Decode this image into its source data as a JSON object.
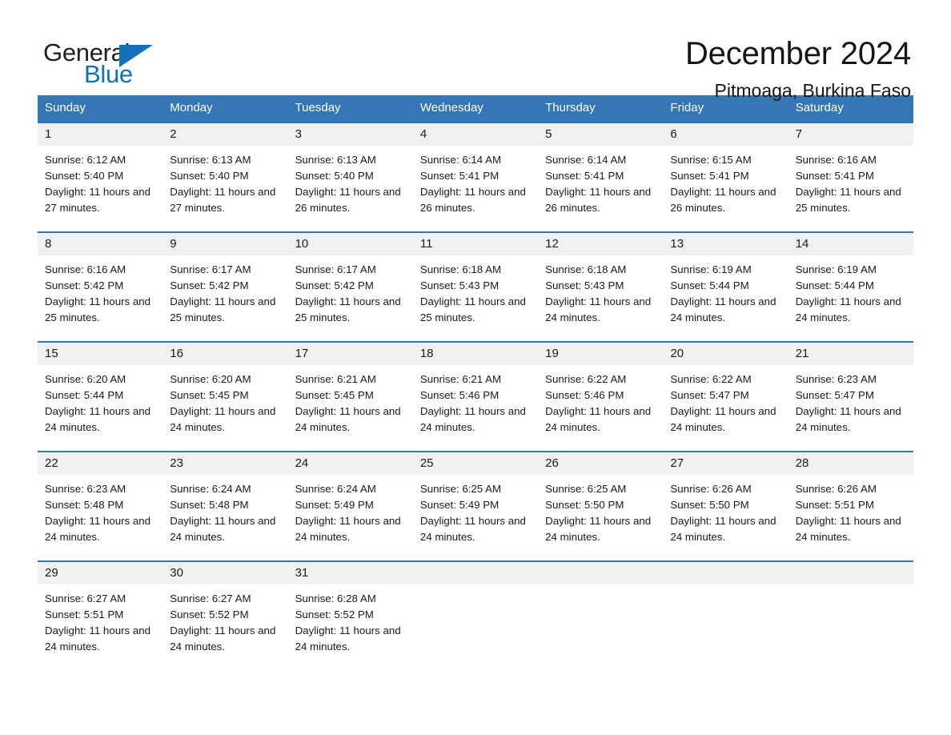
{
  "brand": {
    "name_part1": "General",
    "name_part2": "Blue",
    "logo_icon": "triangle-flag-icon",
    "accent_color": "#1271b8"
  },
  "header": {
    "month_title": "December 2024",
    "location": "Pitmoaga, Burkina Faso"
  },
  "calendar": {
    "header_bg_color": "#3576b5",
    "daynum_bg_color": "#f1f1f1",
    "weekdays": [
      "Sunday",
      "Monday",
      "Tuesday",
      "Wednesday",
      "Thursday",
      "Friday",
      "Saturday"
    ],
    "weeks": [
      {
        "days": [
          {
            "num": "1",
            "sunrise": "Sunrise: 6:12 AM",
            "sunset": "Sunset: 5:40 PM",
            "daylight": "Daylight: 11 hours and 27 minutes."
          },
          {
            "num": "2",
            "sunrise": "Sunrise: 6:13 AM",
            "sunset": "Sunset: 5:40 PM",
            "daylight": "Daylight: 11 hours and 27 minutes."
          },
          {
            "num": "3",
            "sunrise": "Sunrise: 6:13 AM",
            "sunset": "Sunset: 5:40 PM",
            "daylight": "Daylight: 11 hours and 26 minutes."
          },
          {
            "num": "4",
            "sunrise": "Sunrise: 6:14 AM",
            "sunset": "Sunset: 5:41 PM",
            "daylight": "Daylight: 11 hours and 26 minutes."
          },
          {
            "num": "5",
            "sunrise": "Sunrise: 6:14 AM",
            "sunset": "Sunset: 5:41 PM",
            "daylight": "Daylight: 11 hours and 26 minutes."
          },
          {
            "num": "6",
            "sunrise": "Sunrise: 6:15 AM",
            "sunset": "Sunset: 5:41 PM",
            "daylight": "Daylight: 11 hours and 26 minutes."
          },
          {
            "num": "7",
            "sunrise": "Sunrise: 6:16 AM",
            "sunset": "Sunset: 5:41 PM",
            "daylight": "Daylight: 11 hours and 25 minutes."
          }
        ]
      },
      {
        "days": [
          {
            "num": "8",
            "sunrise": "Sunrise: 6:16 AM",
            "sunset": "Sunset: 5:42 PM",
            "daylight": "Daylight: 11 hours and 25 minutes."
          },
          {
            "num": "9",
            "sunrise": "Sunrise: 6:17 AM",
            "sunset": "Sunset: 5:42 PM",
            "daylight": "Daylight: 11 hours and 25 minutes."
          },
          {
            "num": "10",
            "sunrise": "Sunrise: 6:17 AM",
            "sunset": "Sunset: 5:42 PM",
            "daylight": "Daylight: 11 hours and 25 minutes."
          },
          {
            "num": "11",
            "sunrise": "Sunrise: 6:18 AM",
            "sunset": "Sunset: 5:43 PM",
            "daylight": "Daylight: 11 hours and 25 minutes."
          },
          {
            "num": "12",
            "sunrise": "Sunrise: 6:18 AM",
            "sunset": "Sunset: 5:43 PM",
            "daylight": "Daylight: 11 hours and 24 minutes."
          },
          {
            "num": "13",
            "sunrise": "Sunrise: 6:19 AM",
            "sunset": "Sunset: 5:44 PM",
            "daylight": "Daylight: 11 hours and 24 minutes."
          },
          {
            "num": "14",
            "sunrise": "Sunrise: 6:19 AM",
            "sunset": "Sunset: 5:44 PM",
            "daylight": "Daylight: 11 hours and 24 minutes."
          }
        ]
      },
      {
        "days": [
          {
            "num": "15",
            "sunrise": "Sunrise: 6:20 AM",
            "sunset": "Sunset: 5:44 PM",
            "daylight": "Daylight: 11 hours and 24 minutes."
          },
          {
            "num": "16",
            "sunrise": "Sunrise: 6:20 AM",
            "sunset": "Sunset: 5:45 PM",
            "daylight": "Daylight: 11 hours and 24 minutes."
          },
          {
            "num": "17",
            "sunrise": "Sunrise: 6:21 AM",
            "sunset": "Sunset: 5:45 PM",
            "daylight": "Daylight: 11 hours and 24 minutes."
          },
          {
            "num": "18",
            "sunrise": "Sunrise: 6:21 AM",
            "sunset": "Sunset: 5:46 PM",
            "daylight": "Daylight: 11 hours and 24 minutes."
          },
          {
            "num": "19",
            "sunrise": "Sunrise: 6:22 AM",
            "sunset": "Sunset: 5:46 PM",
            "daylight": "Daylight: 11 hours and 24 minutes."
          },
          {
            "num": "20",
            "sunrise": "Sunrise: 6:22 AM",
            "sunset": "Sunset: 5:47 PM",
            "daylight": "Daylight: 11 hours and 24 minutes."
          },
          {
            "num": "21",
            "sunrise": "Sunrise: 6:23 AM",
            "sunset": "Sunset: 5:47 PM",
            "daylight": "Daylight: 11 hours and 24 minutes."
          }
        ]
      },
      {
        "days": [
          {
            "num": "22",
            "sunrise": "Sunrise: 6:23 AM",
            "sunset": "Sunset: 5:48 PM",
            "daylight": "Daylight: 11 hours and 24 minutes."
          },
          {
            "num": "23",
            "sunrise": "Sunrise: 6:24 AM",
            "sunset": "Sunset: 5:48 PM",
            "daylight": "Daylight: 11 hours and 24 minutes."
          },
          {
            "num": "24",
            "sunrise": "Sunrise: 6:24 AM",
            "sunset": "Sunset: 5:49 PM",
            "daylight": "Daylight: 11 hours and 24 minutes."
          },
          {
            "num": "25",
            "sunrise": "Sunrise: 6:25 AM",
            "sunset": "Sunset: 5:49 PM",
            "daylight": "Daylight: 11 hours and 24 minutes."
          },
          {
            "num": "26",
            "sunrise": "Sunrise: 6:25 AM",
            "sunset": "Sunset: 5:50 PM",
            "daylight": "Daylight: 11 hours and 24 minutes."
          },
          {
            "num": "27",
            "sunrise": "Sunrise: 6:26 AM",
            "sunset": "Sunset: 5:50 PM",
            "daylight": "Daylight: 11 hours and 24 minutes."
          },
          {
            "num": "28",
            "sunrise": "Sunrise: 6:26 AM",
            "sunset": "Sunset: 5:51 PM",
            "daylight": "Daylight: 11 hours and 24 minutes."
          }
        ]
      },
      {
        "days": [
          {
            "num": "29",
            "sunrise": "Sunrise: 6:27 AM",
            "sunset": "Sunset: 5:51 PM",
            "daylight": "Daylight: 11 hours and 24 minutes."
          },
          {
            "num": "30",
            "sunrise": "Sunrise: 6:27 AM",
            "sunset": "Sunset: 5:52 PM",
            "daylight": "Daylight: 11 hours and 24 minutes."
          },
          {
            "num": "31",
            "sunrise": "Sunrise: 6:28 AM",
            "sunset": "Sunset: 5:52 PM",
            "daylight": "Daylight: 11 hours and 24 minutes."
          },
          {
            "num": "",
            "sunrise": "",
            "sunset": "",
            "daylight": ""
          },
          {
            "num": "",
            "sunrise": "",
            "sunset": "",
            "daylight": ""
          },
          {
            "num": "",
            "sunrise": "",
            "sunset": "",
            "daylight": ""
          },
          {
            "num": "",
            "sunrise": "",
            "sunset": "",
            "daylight": ""
          }
        ]
      }
    ]
  }
}
